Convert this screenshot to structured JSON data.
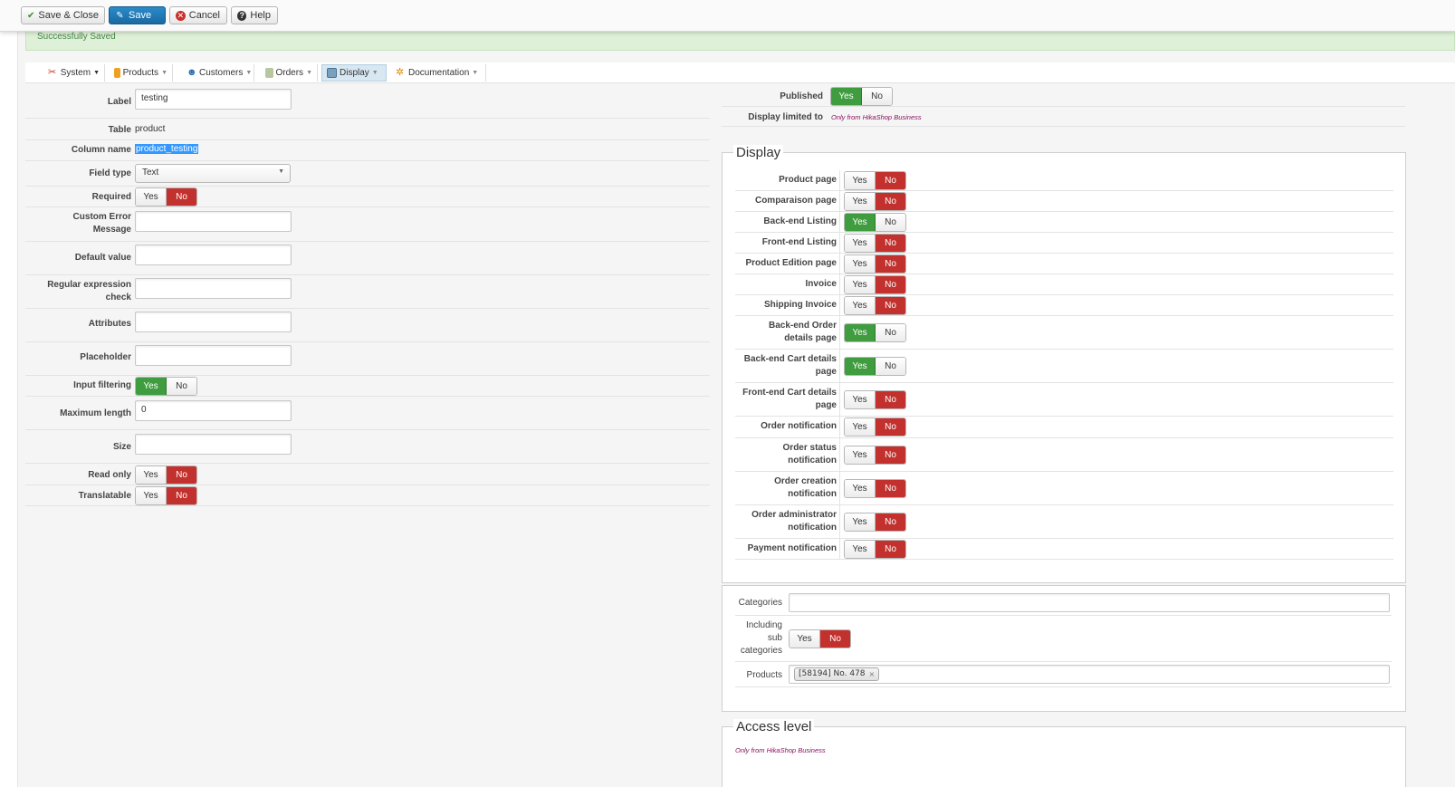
{
  "toolbar": {
    "save_close": "Save & Close",
    "save": "Save",
    "cancel": "Cancel",
    "help": "Help"
  },
  "message": "Successfully Saved",
  "menu": [
    {
      "label": "System",
      "icon": "tools-icon"
    },
    {
      "label": "Products",
      "icon": "box-icon"
    },
    {
      "label": "Customers",
      "icon": "users-icon"
    },
    {
      "label": "Orders",
      "icon": "orders-icon"
    },
    {
      "label": "Display",
      "icon": "display-icon"
    },
    {
      "label": "Documentation",
      "icon": "documentation-icon"
    }
  ],
  "form": {
    "label": {
      "label": "Label",
      "value": "testing"
    },
    "table": {
      "label": "Table",
      "value": "product"
    },
    "column_name": {
      "label": "Column name",
      "value": "product_testing"
    },
    "field_type": {
      "label": "Field type",
      "value": "Text"
    },
    "required": {
      "label": "Required",
      "value": "No"
    },
    "custom_error": {
      "label_1": "Custom Error",
      "label_2": "Message",
      "value": ""
    },
    "default_value": {
      "label": "Default value",
      "value": ""
    },
    "regex": {
      "label_1": "Regular expression",
      "label_2": "check",
      "value": ""
    },
    "attributes": {
      "label": "Attributes",
      "value": ""
    },
    "placeholder": {
      "label": "Placeholder",
      "value": ""
    },
    "input_filtering": {
      "label": "Input filtering",
      "value": "Yes"
    },
    "max_length": {
      "label": "Maximum length",
      "value": "0"
    },
    "size": {
      "label": "Size",
      "value": ""
    },
    "read_only": {
      "label": "Read only",
      "value": "No"
    },
    "translatable": {
      "label": "Translatable",
      "value": "No"
    }
  },
  "toggle": {
    "yes": "Yes",
    "no": "No"
  },
  "right": {
    "published": {
      "label": "Published",
      "value": "Yes"
    },
    "display_limited": {
      "label": "Display limited to",
      "value": "Only from HikaShop Business"
    }
  },
  "display": {
    "legend": "Display",
    "rows": [
      {
        "label_1": "Product page",
        "label_2": "",
        "value": "No"
      },
      {
        "label_1": "Comparaison page",
        "label_2": "",
        "value": "No"
      },
      {
        "label_1": "Back-end Listing",
        "label_2": "",
        "value": "Yes"
      },
      {
        "label_1": "Front-end Listing",
        "label_2": "",
        "value": "No"
      },
      {
        "label_1": "Product Edition page",
        "label_2": "",
        "value": "No"
      },
      {
        "label_1": "Invoice",
        "label_2": "",
        "value": "No"
      },
      {
        "label_1": "Shipping Invoice",
        "label_2": "",
        "value": "No"
      },
      {
        "label_1": "Back-end Order",
        "label_2": "details page",
        "value": "Yes"
      },
      {
        "label_1": "Back-end Cart details",
        "label_2": "page",
        "value": "Yes"
      },
      {
        "label_1": "Front-end Cart details",
        "label_2": "page",
        "value": "No"
      },
      {
        "label_1": "Order notification",
        "label_2": "",
        "value": "No"
      },
      {
        "label_1": "Order status",
        "label_2": "notification",
        "value": "No"
      },
      {
        "label_1": "Order creation",
        "label_2": "notification",
        "value": "No"
      },
      {
        "label_1": "Order administrator",
        "label_2": "notification",
        "value": "No"
      },
      {
        "label_1": "Payment notification",
        "label_2": "",
        "value": "No"
      }
    ]
  },
  "limits": {
    "categories": {
      "label": "Categories",
      "value": ""
    },
    "sub_categories": {
      "label_1": "Including",
      "label_2": "sub",
      "label_3": "categories",
      "value": "No"
    },
    "products": {
      "label": "Products",
      "chip": "[58194] No. 478",
      "remove": "×"
    }
  },
  "access": {
    "legend": "Access level",
    "note": "Only from HikaShop Business"
  },
  "colors": {
    "yes_active": "#3f9c3f",
    "no_active": "#c2312d",
    "primary": "#1a6aa3"
  }
}
